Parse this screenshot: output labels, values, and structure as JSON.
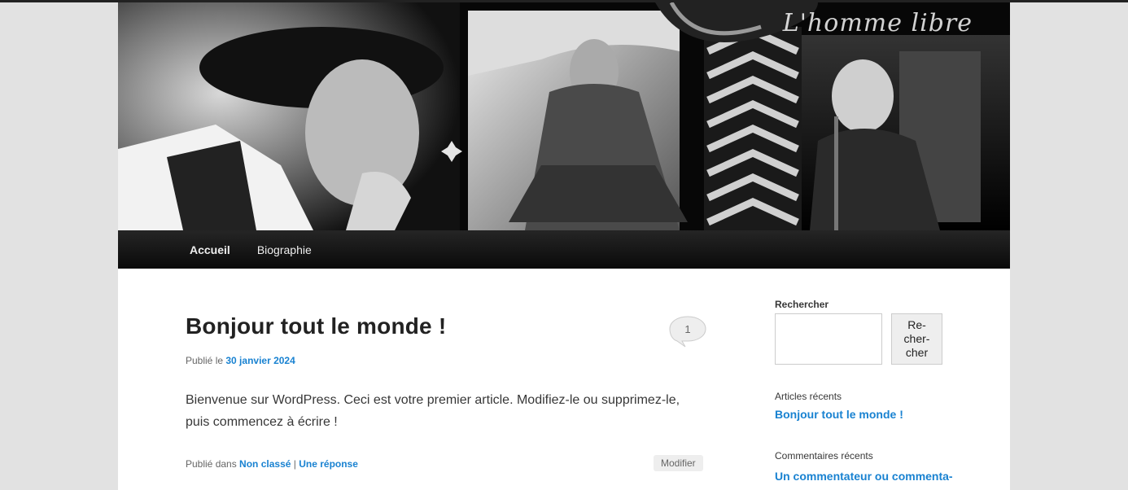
{
  "site": {
    "header_title": "L'homme libre"
  },
  "nav": {
    "items": [
      {
        "label": "Accueil",
        "active": true
      },
      {
        "label": "Biographie",
        "active": false
      }
    ]
  },
  "post": {
    "title": "Bonjour tout le monde !",
    "comment_count": "1",
    "meta_prefix": "Publié le ",
    "date": "30 janvier 2024",
    "body": "Bienvenue sur WordPress. Ceci est votre premier article. Modifiez-le ou supprimez-le, puis commencez à écrire !",
    "footer_prefix": "Publié dans ",
    "category": "Non classé",
    "separator": " | ",
    "reply_link": "Une réponse",
    "edit_label": "Modifier"
  },
  "sidebar": {
    "search_title": "Rechercher",
    "search_button_lines": [
      "Re-",
      "cher-",
      "cher"
    ],
    "recent_posts_title": "Articles récents",
    "recent_posts": [
      "Bonjour tout le monde !"
    ],
    "recent_comments_title": "Commentaires récents",
    "recent_comments": [
      "Un commentateur ou commenta-"
    ]
  },
  "colors": {
    "link": "#1982d1",
    "nav_bg": "#111111",
    "page_bg": "#e2e2e2"
  }
}
